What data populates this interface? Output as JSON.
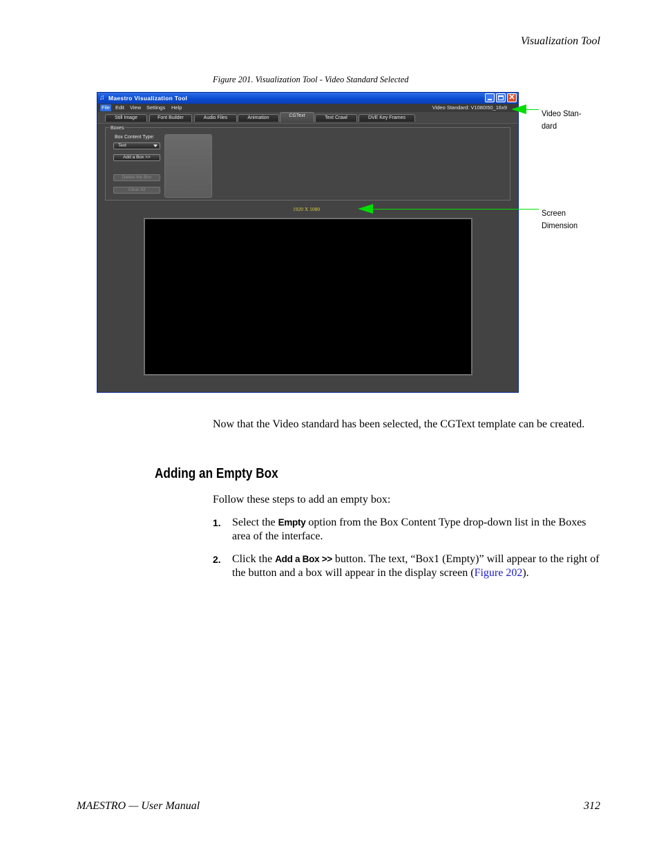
{
  "header": {
    "running_title": "Visualization Tool"
  },
  "figure": {
    "caption": "Figure 201.  Visualization Tool - Video Standard Selected",
    "window": {
      "title": "Maestro Visualization Tool",
      "menu": [
        "File",
        "Edit",
        "View",
        "Settings",
        "Help"
      ],
      "video_standard": "Video Standard:  V1080I50_16x9",
      "tabs": [
        "Still Image",
        "Font Builder",
        "Audio Files",
        "Animation",
        "CGText",
        "Text Crawl",
        "DVE Key Frames"
      ],
      "active_tab": "CGText",
      "boxes_panel": {
        "group_label": "Boxes",
        "content_type_label": "Box Content Type:",
        "content_type_value": "Text",
        "add_button": "Add a Box >>",
        "delete_button": "Delete the Box",
        "clear_button": "Clear All"
      },
      "screen_dimension": "1920 X 1080"
    },
    "callouts": {
      "video_standard_line1": "Video Stan-",
      "video_standard_line2": "dard",
      "screen_dimension_line1": "Screen",
      "screen_dimension_line2": "Dimension"
    },
    "callout_color": "#00dd00"
  },
  "body": {
    "intro": "Now that the Video standard has been selected, the CGText template can be created.",
    "section_heading": "Adding an Empty Box",
    "lead": "Follow these steps to add an empty box:",
    "steps": [
      {
        "num": "1.",
        "pre": "Select the ",
        "term": "Empty",
        "post": " option from the Box Content Type drop-down list in the Boxes area of the interface."
      },
      {
        "num": "2.",
        "pre": "Click the ",
        "term": "Add a Box >>",
        "post": " button. The text, “Box1 (Empty)” will appear to the right of the button and a box will appear in the display screen (",
        "link": "Figure 202",
        "end": ")."
      }
    ]
  },
  "footer": {
    "left": "MAESTRO  —  User Manual",
    "page_number": "312"
  }
}
